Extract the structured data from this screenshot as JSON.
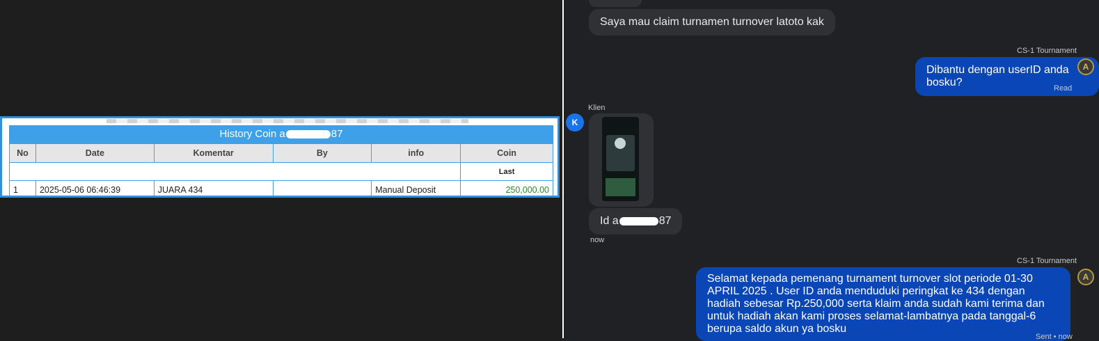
{
  "coin_history": {
    "title_prefix": "History Coin a",
    "title_suffix": "87",
    "columns": [
      "No",
      "Date",
      "Komentar",
      "By",
      "info",
      "Coin"
    ],
    "last_label": "Last",
    "rows": [
      {
        "no": "1",
        "date": "2025-05-06 06:46:39",
        "komentar": "JUARA 434",
        "by": "",
        "info": "Manual Deposit",
        "coin": "250,000.00"
      }
    ]
  },
  "chat": {
    "msg_claim": "Saya mau claim turnamen turnover latoto kak",
    "agent_name_1": "CS-1 Tournament",
    "msg_userid": "Dibantu dengan userID anda bosku?",
    "status_read": "Read",
    "client_name": "Klien",
    "client_avatar": "K",
    "msg_id_prefix": "Id a",
    "msg_id_suffix": "87",
    "time_now": "now",
    "agent_name_2": "CS-1 Tournament",
    "msg_congrats": "Selamat kepada pemenang turnament turnover slot periode 01-30 APRIL 2025 . User ID anda menduduki peringkat ke 434 dengan hadiah sebesar Rp.250,000 serta klaim anda sudah kami terima dan untuk hadiah akan kami proses selamat-lambatnya pada tanggal-6 berupa saldo akun ya bosku",
    "status_sent": "Sent • now",
    "agent_avatar": "A"
  },
  "colors": {
    "table_accent": "#3ea0e8",
    "agent_bubble": "#0b46b6",
    "client_bubble": "#303134",
    "coin_amount": "#2a8a2a"
  }
}
